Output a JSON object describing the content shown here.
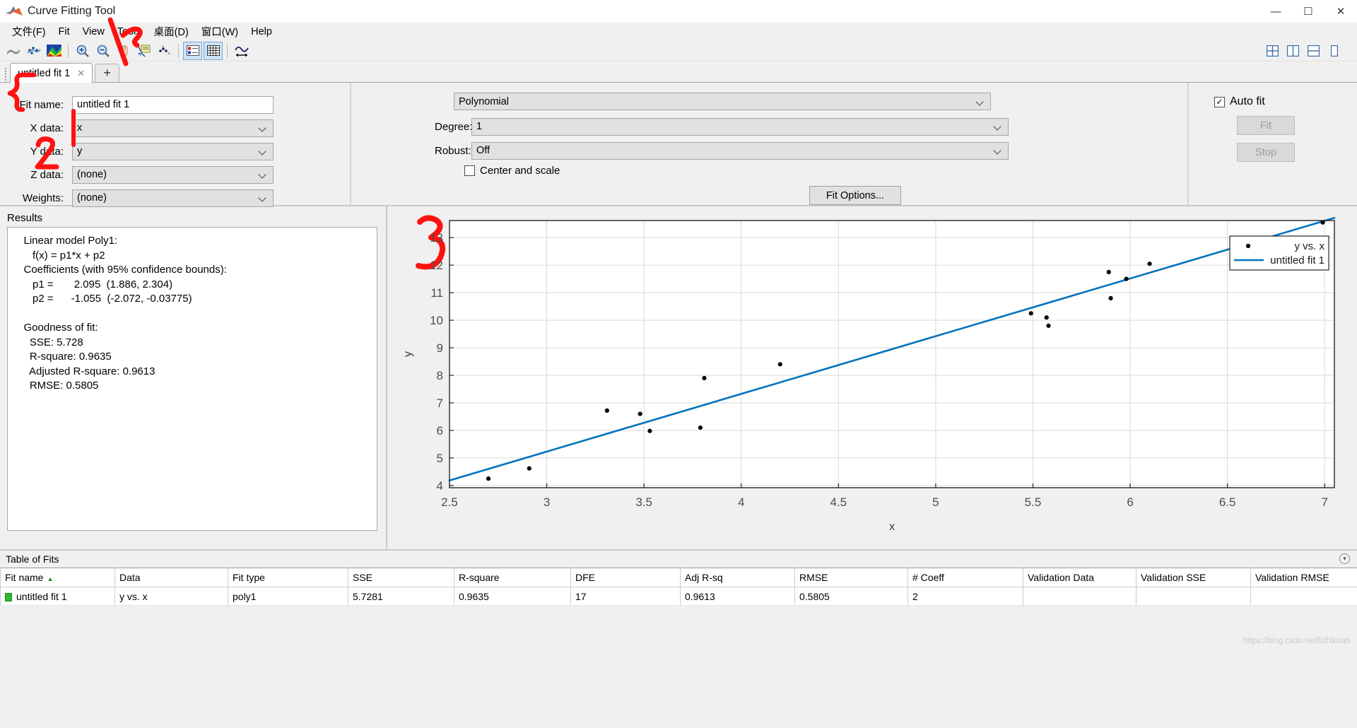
{
  "window": {
    "title": "Curve Fitting Tool",
    "minimize": "—",
    "maximize": "☐",
    "close": "✕"
  },
  "menubar": [
    {
      "label": "文件(F)"
    },
    {
      "label": "Fit"
    },
    {
      "label": "View"
    },
    {
      "label": "Tools"
    },
    {
      "label": "桌面(D)"
    },
    {
      "label": "窗口(W)"
    },
    {
      "label": "Help"
    }
  ],
  "toolbar": {
    "items": [
      {
        "name": "surface-icon"
      },
      {
        "name": "data-points-icon"
      },
      {
        "name": "colormap-icon"
      },
      {
        "name": "zoom-in-icon"
      },
      {
        "name": "zoom-out-icon"
      },
      {
        "name": "pan-icon"
      },
      {
        "name": "data-cursor-icon"
      },
      {
        "name": "exclude-outliers-icon"
      },
      {
        "name": "legend-toggle-icon"
      },
      {
        "name": "grid-toggle-icon"
      },
      {
        "name": "axes-limits-icon"
      }
    ],
    "right_items": [
      {
        "name": "layout-grid-icon"
      },
      {
        "name": "layout-split-vertical-icon"
      },
      {
        "name": "layout-split-horizontal-icon"
      },
      {
        "name": "layout-single-icon"
      }
    ]
  },
  "tabs": {
    "items": [
      {
        "label": "untitled fit 1",
        "close": "✕"
      }
    ],
    "add_label": "+"
  },
  "fit_panel": {
    "fit_name_label": "Fit name:",
    "fit_name_value": "untitled fit 1",
    "x_data_label": "X data:",
    "x_data_value": "x",
    "y_data_label": "Y data:",
    "y_data_value": "y",
    "z_data_label": "Z data:",
    "z_data_value": "(none)",
    "weights_label": "Weights:",
    "weights_value": "(none)"
  },
  "model_panel": {
    "fit_type_value": "Polynomial",
    "degree_label": "Degree:",
    "degree_value": "1",
    "robust_label": "Robust:",
    "robust_value": "Off",
    "center_scale_label": "Center and scale",
    "center_scale_checked": false,
    "fit_options_label": "Fit Options..."
  },
  "action_panel": {
    "auto_fit_label": "Auto fit",
    "auto_fit_checked": true,
    "auto_fit_mark": "✓",
    "fit_label": "Fit",
    "stop_label": "Stop"
  },
  "results": {
    "title": "Results",
    "text": "   Linear model Poly1:\n      f(x) = p1*x + p2\n   Coefficients (with 95% confidence bounds):\n      p1 =       2.095  (1.886, 2.304)\n      p2 =      -1.055  (-2.072, -0.03775)\n\n   Goodness of fit:\n     SSE: 5.728\n     R-square: 0.9635\n     Adjusted R-square: 0.9613\n     RMSE: 0.5805"
  },
  "annotations": [
    {
      "name": "annotation-1",
      "text": "1",
      "color": "#ff0000"
    },
    {
      "name": "annotation-2",
      "text": "2",
      "color": "#ff0000"
    },
    {
      "name": "annotation-3",
      "text": "3",
      "color": "#ff0000"
    },
    {
      "name": "annotation-check",
      "text": "✓",
      "color": "#ff0000"
    },
    {
      "name": "annotation-brace",
      "text": "{",
      "color": "#ff0000"
    }
  ],
  "chart_data": {
    "type": "scatter",
    "title": "",
    "xlabel": "x",
    "ylabel": "y",
    "xlim": [
      2.5,
      7.05
    ],
    "ylim": [
      3.92,
      13.62
    ],
    "xticks": [
      2.5,
      3,
      3.5,
      4,
      4.5,
      5,
      5.5,
      6,
      6.5,
      7
    ],
    "xticklabels": [
      "2.5",
      "3",
      "3.5",
      "4",
      "4.5",
      "5",
      "5.5",
      "6",
      "6.5",
      "7"
    ],
    "yticks": [
      4,
      5,
      6,
      7,
      8,
      9,
      10,
      11,
      12,
      13
    ],
    "yticklabels": [
      "4",
      "5",
      "6",
      "7",
      "8",
      "9",
      "10",
      "11",
      "12",
      "13"
    ],
    "grid": true,
    "legend_position": "top-right",
    "series": [
      {
        "name": "y vs. x",
        "type": "scatter",
        "marker": "circle",
        "color": "#000000",
        "points": [
          [
            2.7,
            4.25
          ],
          [
            2.91,
            4.62
          ],
          [
            3.31,
            6.72
          ],
          [
            3.48,
            6.6
          ],
          [
            3.53,
            5.98
          ],
          [
            3.79,
            6.1
          ],
          [
            3.81,
            7.9
          ],
          [
            4.2,
            8.4
          ],
          [
            5.49,
            10.25
          ],
          [
            5.57,
            10.1
          ],
          [
            5.58,
            9.8
          ],
          [
            5.89,
            11.75
          ],
          [
            5.9,
            10.8
          ],
          [
            5.98,
            11.5
          ],
          [
            6.1,
            12.05
          ],
          [
            6.99,
            13.55
          ]
        ]
      },
      {
        "name": "untitled fit 1",
        "type": "line",
        "color": "#0072bd",
        "equation": "f(x) = 2.095*x - 1.055",
        "x_range": [
          2.5,
          7.05
        ]
      }
    ]
  },
  "table_of_fits": {
    "title": "Table of Fits",
    "sort_indicator": "▲",
    "columns": [
      "Fit name",
      "Data",
      "Fit type",
      "SSE",
      "R-square",
      "DFE",
      "Adj R-sq",
      "RMSE",
      "# Coeff",
      "Validation Data",
      "Validation SSE",
      "Validation RMSE"
    ],
    "rows": [
      {
        "fit_name": "untitled fit 1",
        "data": "y vs. x",
        "fit_type": "poly1",
        "sse": "5.7281",
        "r_square": "0.9635",
        "dfe": "17",
        "adj_r_sq": "0.9613",
        "rmse": "0.5805",
        "num_coeff": "2",
        "validation_data": "",
        "validation_sse": "",
        "validation_rmse": ""
      }
    ]
  },
  "watermark": "https://blog.csdn.net/lizhikuan"
}
